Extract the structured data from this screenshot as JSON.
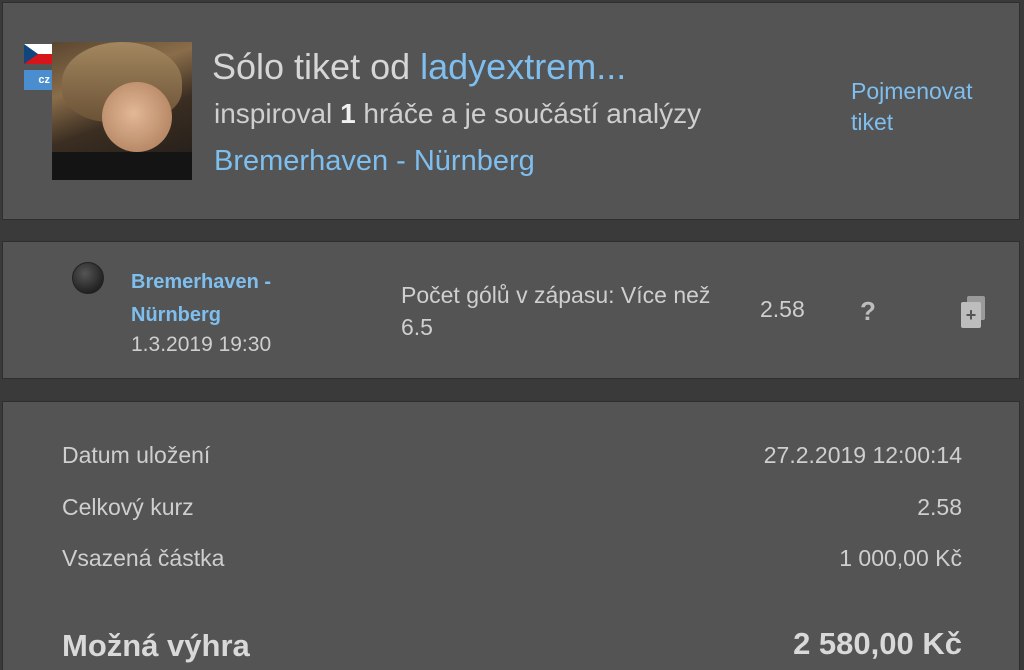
{
  "header": {
    "title_prefix": "Sólo tiket od ",
    "author": "ladyextrem...",
    "subtitle_pre": "inspiroval ",
    "subtitle_count": "1",
    "subtitle_post": " hráče a je součástí analýzy",
    "match_link": "Bremerhaven - Nürnberg",
    "name_ticket_label": "Pojmenovat tiket",
    "lang_badge": "cz"
  },
  "selection": {
    "match": "Bremerhaven - Nürnberg",
    "datetime": "1.3.2019 19:30",
    "bet": "Počet gólů v zápasu: Více než 6.5",
    "odds": "2.58",
    "help_symbol": "?",
    "copy_symbol": "+"
  },
  "summary": {
    "rows": [
      {
        "label": "Datum uložení",
        "value": "27.2.2019 12:00:14"
      },
      {
        "label": "Celkový kurz",
        "value": "2.58"
      },
      {
        "label": "Vsazená částka",
        "value": "1 000,00 Kč"
      }
    ],
    "win_label": "Možná výhra",
    "win_value": "2 580,00 Kč"
  },
  "icons": {
    "flag": "czech-flag-icon",
    "help": "question-icon",
    "copy": "copy-add-icon",
    "status": "status-dot-icon"
  },
  "colors": {
    "background": "#3a3a3a",
    "panel": "#545454",
    "link": "#7fbfef",
    "text": "#d6d6d6"
  }
}
